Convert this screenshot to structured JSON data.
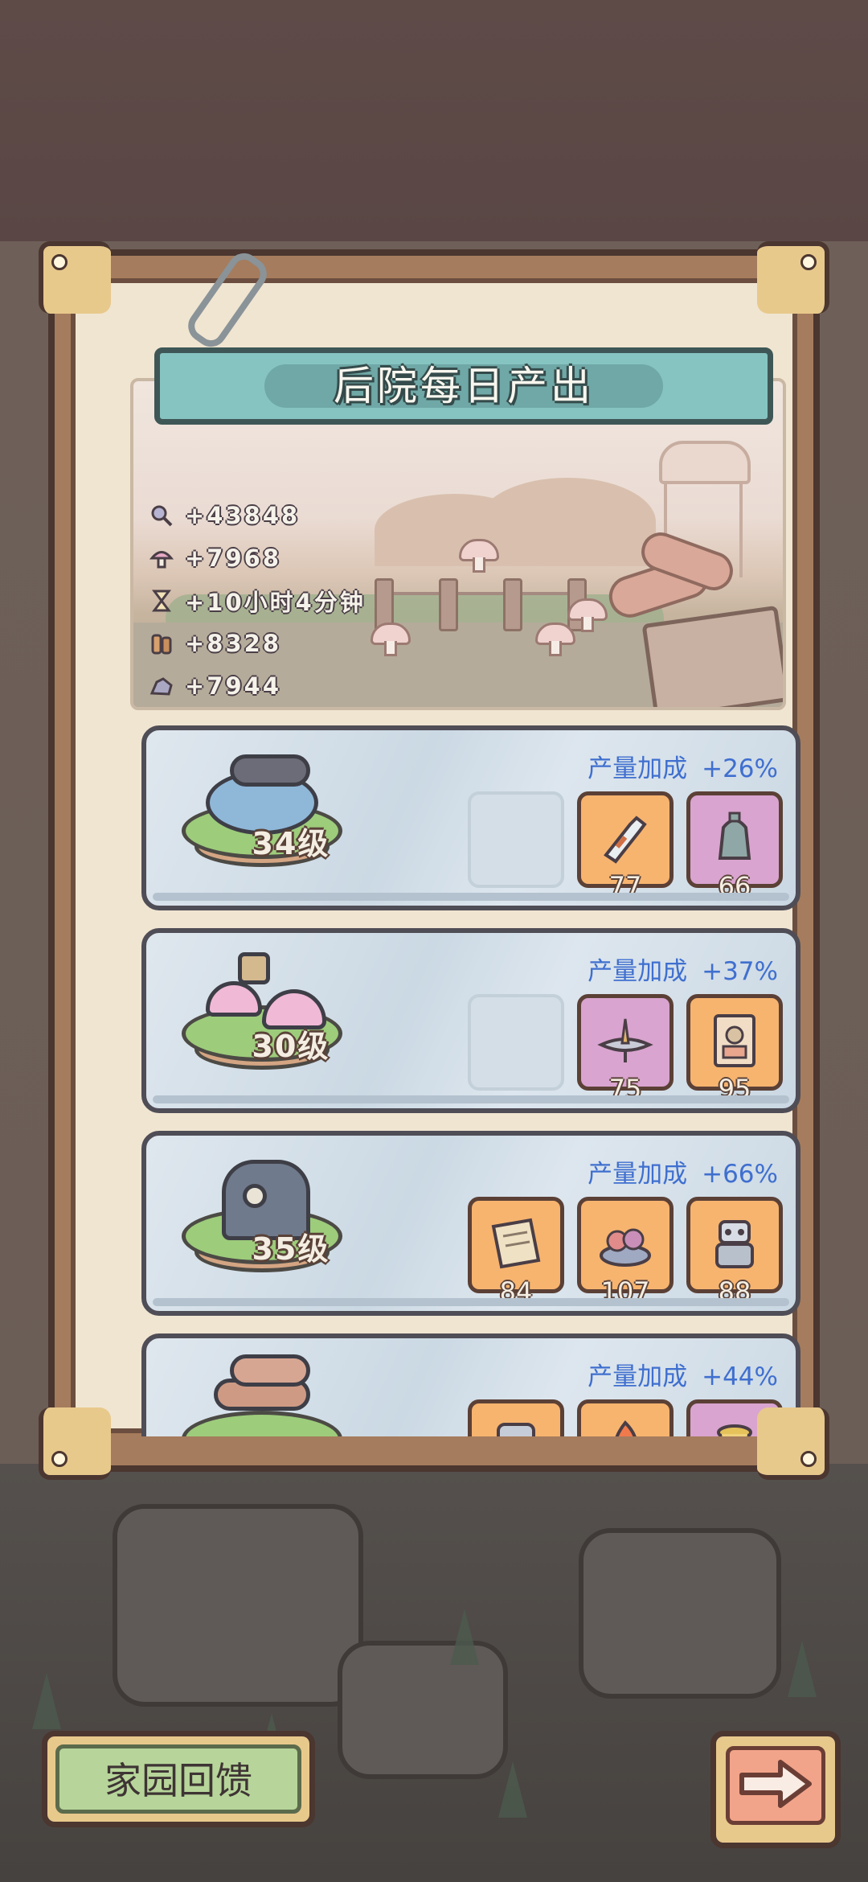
{
  "header": {
    "title": "后院每日产出"
  },
  "daily_output": [
    {
      "icon": "magnifier-icon",
      "value": "+43848"
    },
    {
      "icon": "mushroom-icon",
      "value": "+7968"
    },
    {
      "icon": "hourglass-icon",
      "value": "+10小时4分钟"
    },
    {
      "icon": "wood-icon",
      "value": "+8328"
    },
    {
      "icon": "ore-icon",
      "value": "+7944"
    }
  ],
  "buildings": [
    {
      "name": "pond-island",
      "level": "34级",
      "bonus_label": "产量加成",
      "bonus_value": "+26%",
      "slots": [
        {
          "type": "empty"
        },
        {
          "type": "orange",
          "icon": "bottle-icon",
          "count": "77"
        },
        {
          "type": "pink",
          "icon": "bell-icon",
          "count": "66"
        }
      ]
    },
    {
      "name": "mushroom-island",
      "level": "30级",
      "bonus_label": "产量加成",
      "bonus_value": "+37%",
      "slots": [
        {
          "type": "empty"
        },
        {
          "type": "pink",
          "icon": "spinning-top-icon",
          "count": "75"
        },
        {
          "type": "orange",
          "icon": "portrait-card-icon",
          "count": "95"
        }
      ]
    },
    {
      "name": "machine-island",
      "level": "35级",
      "bonus_label": "产量加成",
      "bonus_value": "+66%",
      "slots": [
        {
          "type": "orange",
          "icon": "paper-icon",
          "count": "84"
        },
        {
          "type": "orange",
          "icon": "gem-pile-icon",
          "count": "107"
        },
        {
          "type": "orange",
          "icon": "robot-icon",
          "count": "88"
        }
      ]
    },
    {
      "name": "lumber-island",
      "level": "",
      "bonus_label": "产量加成",
      "bonus_value": "+44%",
      "slots": [
        {
          "type": "orange",
          "icon": "stone-icon",
          "count": ""
        },
        {
          "type": "orange",
          "icon": "flame-icon",
          "count": ""
        },
        {
          "type": "pink",
          "icon": "pot-icon",
          "count": ""
        }
      ]
    }
  ],
  "footer": {
    "feedback_label": "家园回馈",
    "next_icon": "arrow-right-icon"
  }
}
